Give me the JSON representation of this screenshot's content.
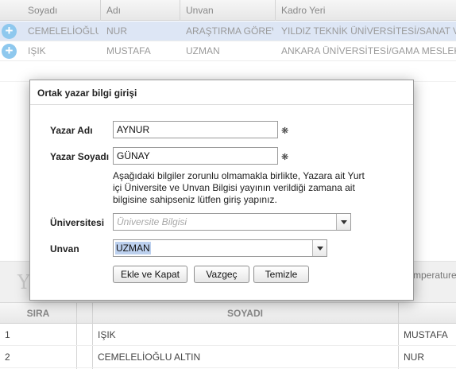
{
  "top_grid": {
    "columns": [
      "Soyadı",
      "Adı",
      "Unvan",
      "Kadro Yeri"
    ],
    "rows": [
      {
        "soyadi": "CEMELELİOĞLU ALTIN",
        "adi": "NUR",
        "unvan": "ARAŞTIRMA GÖREVLİSİ",
        "kadro_yeri": "YILDIZ TEKNİK ÜNİVERSİTESİ/SANAT VE TASARIM FAKÜLTESİ"
      },
      {
        "soyadi": "IŞIK",
        "adi": "MUSTAFA",
        "unvan": "UZMAN",
        "kadro_yeri": "ANKARA ÜNİVERSİTESİ/GAMA MESLEK YÜKSEKOKULU"
      }
    ],
    "add_icon": "plus-circle-icon"
  },
  "dialog": {
    "title": "Ortak yazar bilgi girişi",
    "yazar_adi_label": "Yazar Adı",
    "yazar_adi_value": "AYNUR",
    "yazar_soyadi_label": "Yazar Soyadı",
    "yazar_soyadi_value": "GÜNAY",
    "required_mark": "❋",
    "info_text": "Aşağıdaki bilgiler zorunlu olmamakla birlikte,  Yazara ait Yurt içi Üniversite ve Unvan Bilgisi yayının verildiği zamana ait bilgisine sahipseniz lütfen giriş yapınız.",
    "universite_label": "Üniversitesi",
    "universite_placeholder": "Üniversite Bilgisi",
    "unvan_label": "Unvan",
    "unvan_value": "UZMAN",
    "buttons": {
      "save_close": "Ekle ve Kapat",
      "cancel": "Vazgeç",
      "clear": "Temizle"
    },
    "dropdown_icon": "chevron-down-icon"
  },
  "middle": {
    "partial_heading": "Y",
    "partial_text": "mperature"
  },
  "bottom_grid": {
    "columns": [
      "SIRA",
      "SOYADI"
    ],
    "rows": [
      {
        "sira": "1",
        "soyadi": "IŞIK",
        "adi": "MUSTAFA"
      },
      {
        "sira": "2",
        "soyadi": "CEMELELİOĞLU ALTIN",
        "adi": "NUR"
      }
    ]
  },
  "colors": {
    "selected_row": "#dde6f5",
    "add_icon": "#8ec8ee",
    "selection_highlight": "#bcd0ee"
  }
}
